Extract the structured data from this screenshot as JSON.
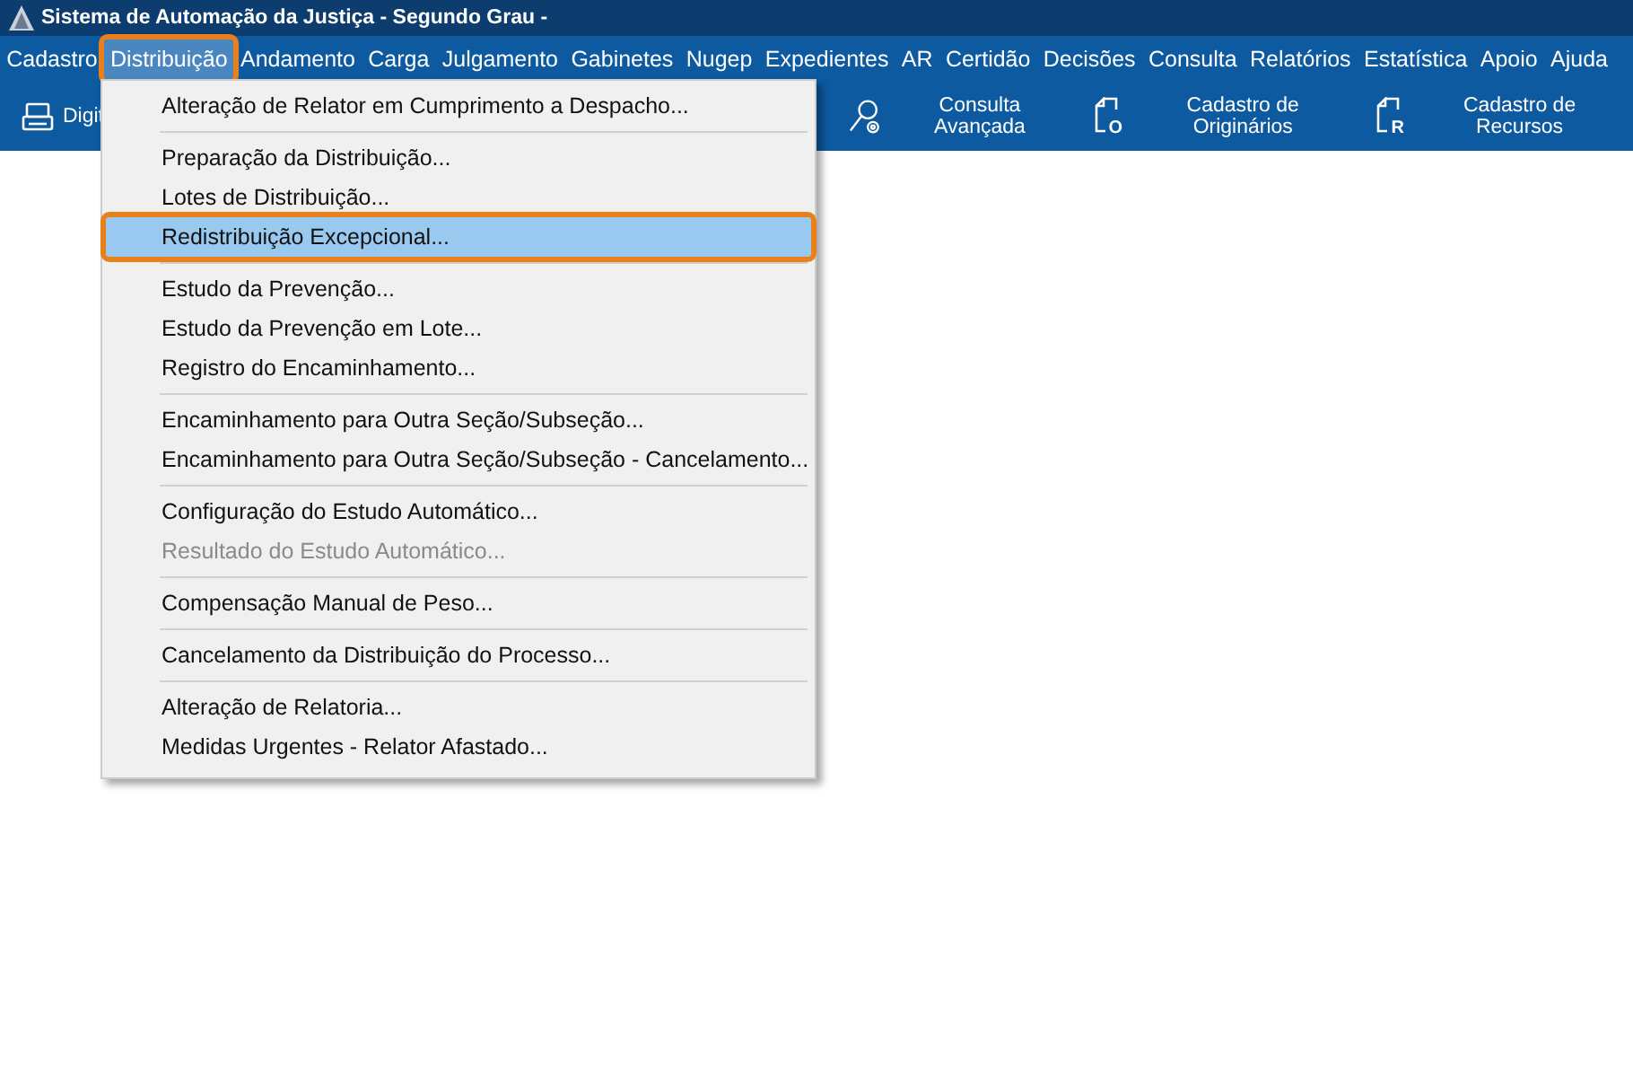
{
  "window": {
    "title": "Sistema de Automação da Justiça - Segundo Grau -"
  },
  "menubar": [
    {
      "label": "Cadastro",
      "selected": false
    },
    {
      "label": "Distribuição",
      "selected": true
    },
    {
      "label": "Andamento",
      "selected": false
    },
    {
      "label": "Carga",
      "selected": false
    },
    {
      "label": "Julgamento",
      "selected": false
    },
    {
      "label": "Gabinetes",
      "selected": false
    },
    {
      "label": "Nugep",
      "selected": false
    },
    {
      "label": "Expedientes",
      "selected": false
    },
    {
      "label": "AR",
      "selected": false
    },
    {
      "label": "Certidão",
      "selected": false
    },
    {
      "label": "Decisões",
      "selected": false
    },
    {
      "label": "Consulta",
      "selected": false
    },
    {
      "label": "Relatórios",
      "selected": false
    },
    {
      "label": "Estatística",
      "selected": false
    },
    {
      "label": "Apoio",
      "selected": false
    },
    {
      "label": "Ajuda",
      "selected": false
    }
  ],
  "toolbar": [
    {
      "kind": "scanner",
      "label": "Digit"
    },
    {
      "kind": "search",
      "label": "Consulta Avançada"
    },
    {
      "kind": "document",
      "letter": "O",
      "label": "Cadastro de Originários"
    },
    {
      "kind": "document",
      "letter": "R",
      "label": "Cadastro de Recursos"
    }
  ],
  "menu": [
    {
      "kind": "item",
      "label": "Alteração de Relator em Cumprimento a Despacho...",
      "selected": false,
      "disabled": false
    },
    {
      "kind": "separator"
    },
    {
      "kind": "item",
      "label": "Preparação da Distribuição...",
      "selected": false,
      "disabled": false
    },
    {
      "kind": "item",
      "label": "Lotes de Distribuição...",
      "selected": false,
      "disabled": false
    },
    {
      "kind": "item",
      "label": "Redistribuição Excepcional...",
      "selected": true,
      "disabled": false
    },
    {
      "kind": "separator"
    },
    {
      "kind": "item",
      "label": "Estudo da Prevenção...",
      "selected": false,
      "disabled": false
    },
    {
      "kind": "item",
      "label": "Estudo da Prevenção em Lote...",
      "selected": false,
      "disabled": false
    },
    {
      "kind": "item",
      "label": "Registro do Encaminhamento...",
      "selected": false,
      "disabled": false
    },
    {
      "kind": "separator"
    },
    {
      "kind": "item",
      "label": "Encaminhamento para Outra Seção/Subseção...",
      "selected": false,
      "disabled": false
    },
    {
      "kind": "item",
      "label": "Encaminhamento para Outra Seção/Subseção - Cancelamento...",
      "selected": false,
      "disabled": false
    },
    {
      "kind": "separator"
    },
    {
      "kind": "item",
      "label": "Configuração do Estudo Automático...",
      "selected": false,
      "disabled": false
    },
    {
      "kind": "item",
      "label": "Resultado do Estudo Automático...",
      "selected": false,
      "disabled": true
    },
    {
      "kind": "separator"
    },
    {
      "kind": "item",
      "label": "Compensação Manual de Peso...",
      "selected": false,
      "disabled": false
    },
    {
      "kind": "separator"
    },
    {
      "kind": "item",
      "label": "Cancelamento da Distribuição do Processo...",
      "selected": false,
      "disabled": false
    },
    {
      "kind": "separator"
    },
    {
      "kind": "item",
      "label": "Alteração de Relatoria...",
      "selected": false,
      "disabled": false
    },
    {
      "kind": "item",
      "label": "Medidas Urgentes - Relator Afastado...",
      "selected": false,
      "disabled": false
    }
  ]
}
